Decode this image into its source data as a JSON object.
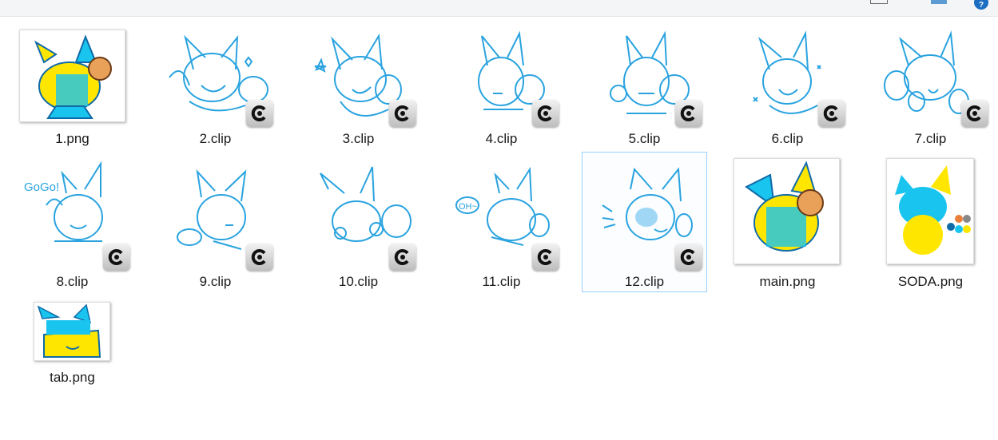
{
  "window": {
    "toolbar_icons": [
      "details-view-icon",
      "tiles-view-icon",
      "help-icon"
    ]
  },
  "files": [
    {
      "name": "1.png",
      "kind": "png",
      "selected": false
    },
    {
      "name": "2.clip",
      "kind": "clip",
      "selected": false
    },
    {
      "name": "3.clip",
      "kind": "clip",
      "selected": false
    },
    {
      "name": "4.clip",
      "kind": "clip",
      "selected": false
    },
    {
      "name": "5.clip",
      "kind": "clip",
      "selected": false
    },
    {
      "name": "6.clip",
      "kind": "clip",
      "selected": false
    },
    {
      "name": "7.clip",
      "kind": "clip",
      "selected": false
    },
    {
      "name": "8.clip",
      "kind": "clip",
      "selected": false
    },
    {
      "name": "9.clip",
      "kind": "clip",
      "selected": false
    },
    {
      "name": "10.clip",
      "kind": "clip",
      "selected": false
    },
    {
      "name": "11.clip",
      "kind": "clip",
      "selected": false
    },
    {
      "name": "12.clip",
      "kind": "clip",
      "selected": true
    },
    {
      "name": "main.png",
      "kind": "png",
      "selected": false
    },
    {
      "name": "SODA.png",
      "kind": "png",
      "selected": false
    },
    {
      "name": "tab.png",
      "kind": "png",
      "selected": false
    }
  ],
  "sketch_texts": {
    "go_go": "GoGo!",
    "oh": "OH~"
  },
  "colors": {
    "sketch": "#29a3e0",
    "yellow": "#ffe600",
    "cyan": "#19c4ef",
    "selection": "#99d1ff"
  }
}
